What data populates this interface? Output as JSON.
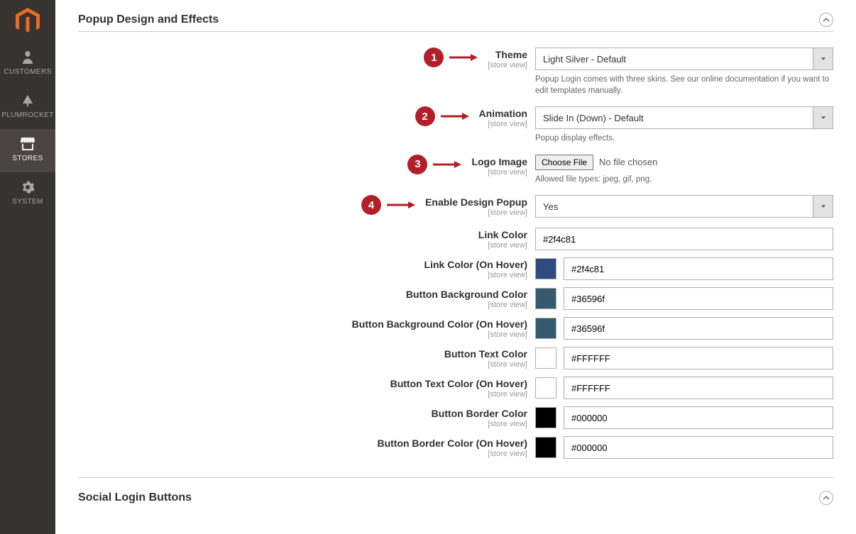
{
  "sidebar": {
    "items": [
      {
        "label": "CUSTOMERS"
      },
      {
        "label": "PLUMROCKET"
      },
      {
        "label": "STORES"
      },
      {
        "label": "SYSTEM"
      }
    ]
  },
  "section1": {
    "title": "Popup Design and Effects"
  },
  "section2": {
    "title": "Social Login Buttons"
  },
  "callouts": [
    "1",
    "2",
    "3",
    "4"
  ],
  "scope": "[store view]",
  "fields": {
    "theme": {
      "label": "Theme",
      "value": "Light Silver - Default",
      "help": "Popup Login comes with three skins. See our online documentation if you want to edit templates manually."
    },
    "animation": {
      "label": "Animation",
      "value": "Slide In (Down) - Default",
      "help": "Popup display effects."
    },
    "logo": {
      "label": "Logo Image",
      "button": "Choose File",
      "nofile": "No file chosen",
      "help": "Allowed file types: jpeg, gif, png."
    },
    "enable": {
      "label": "Enable Design Popup",
      "value": "Yes"
    },
    "linkColor": {
      "label": "Link Color",
      "value": "#2f4c81"
    },
    "linkColorHover": {
      "label": "Link Color (On Hover)",
      "value": "#2f4c81",
      "swatch": "#2f4c81"
    },
    "btnBg": {
      "label": "Button Background Color",
      "value": "#36596f",
      "swatch": "#36596f"
    },
    "btnBgHover": {
      "label": "Button Background Color (On Hover)",
      "value": "#36596f",
      "swatch": "#36596f"
    },
    "btnText": {
      "label": "Button Text Color",
      "value": "#FFFFFF",
      "swatch": "#FFFFFF"
    },
    "btnTextHover": {
      "label": "Button Text Color (On Hover)",
      "value": "#FFFFFF",
      "swatch": "#FFFFFF"
    },
    "btnBorder": {
      "label": "Button Border Color",
      "value": "#000000",
      "swatch": "#000000"
    },
    "btnBorderHover": {
      "label": "Button Border Color (On Hover)",
      "value": "#000000",
      "swatch": "#000000"
    }
  }
}
